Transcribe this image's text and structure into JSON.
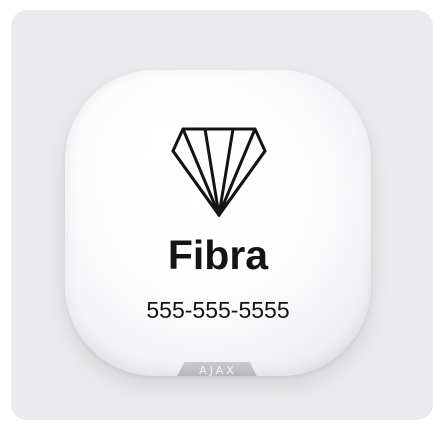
{
  "device": {
    "brand_name": "Fibra",
    "phone": "555-555-5555",
    "maker": "AJAX"
  },
  "logo": {
    "icon": "diamond-icon",
    "stroke_color": "#141414"
  },
  "colors": {
    "backdrop": "#ebebed",
    "device_face": "#ffffff",
    "text": "#141414",
    "tab": "#b3b4b9"
  }
}
